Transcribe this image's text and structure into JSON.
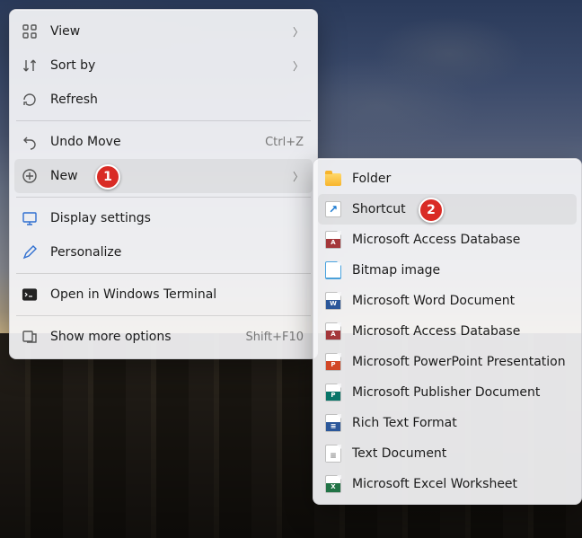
{
  "mainMenu": {
    "view": "View",
    "sortBy": "Sort by",
    "refresh": "Refresh",
    "undoMove": "Undo Move",
    "undoMoveKey": "Ctrl+Z",
    "new": "New",
    "displaySettings": "Display settings",
    "personalize": "Personalize",
    "openTerminal": "Open in Windows Terminal",
    "showMore": "Show more options",
    "showMoreKey": "Shift+F10"
  },
  "subMenu": {
    "folder": "Folder",
    "shortcut": "Shortcut",
    "access1": "Microsoft Access Database",
    "bitmap": "Bitmap image",
    "word": "Microsoft Word Document",
    "access2": "Microsoft Access Database",
    "ppt": "Microsoft PowerPoint Presentation",
    "pub": "Microsoft Publisher Document",
    "rtf": "Rich Text Format",
    "txt": "Text Document",
    "xls": "Microsoft Excel Worksheet"
  },
  "badges": {
    "one": "1",
    "two": "2"
  },
  "colors": {
    "word": "#2b579a",
    "access": "#a4373a",
    "ppt": "#d24726",
    "pub": "#077568",
    "xls": "#217346",
    "rtf": "#2b579a"
  }
}
